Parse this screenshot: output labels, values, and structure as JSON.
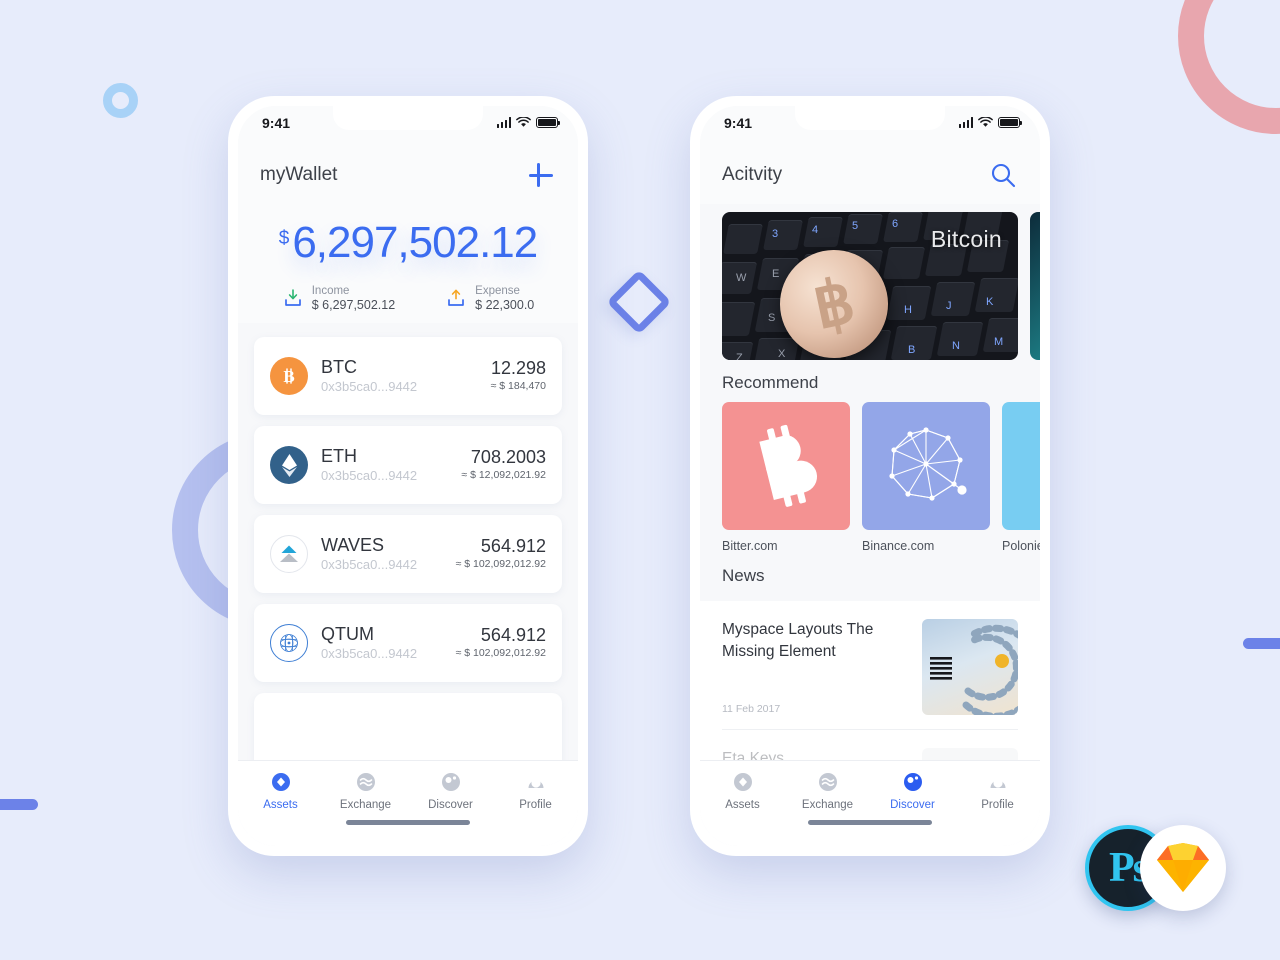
{
  "background": {
    "color": "#e7ecfb",
    "decorations": [
      {
        "name": "ring-small",
        "color": "#a8d2f7"
      },
      {
        "name": "ring-pink",
        "color": "#e8a6ae"
      },
      {
        "name": "ring-periwinkle",
        "color": "#b5c0ef"
      },
      {
        "name": "bar-left",
        "color": "#6c82e8"
      },
      {
        "name": "bar-right",
        "color": "#6c82e8"
      },
      {
        "name": "diamond-mark",
        "color": "#6c82e8"
      }
    ]
  },
  "badges": {
    "photoshop_label": "Ps",
    "photoshop_bg": "#16222c",
    "photoshop_accent": "#31c5f0",
    "sketch_accent": "#f7b500"
  },
  "phone_left": {
    "statusbar": {
      "time": "9:41"
    },
    "header": {
      "title": "myWallet",
      "add_label": "+"
    },
    "balance": {
      "currency_symbol": "$",
      "amount": "6,297,502.12",
      "income_label": "Income",
      "income_value": "$ 6,297,502.12",
      "expense_label": "Expense",
      "expense_value": "$ 22,300.0",
      "accent": "#3b6cf0"
    },
    "coins": [
      {
        "symbol": "BTC",
        "address": "0x3b5ca0...9442",
        "amount": "12.298",
        "usd": "≈ $ 184,470",
        "icon": "bitcoin-icon",
        "color": "#f5943f"
      },
      {
        "symbol": "ETH",
        "address": "0x3b5ca0...9442",
        "amount": "708.2003",
        "usd": "≈ $ 12,092,021.92",
        "icon": "ethereum-icon",
        "color": "#32618a"
      },
      {
        "symbol": "WAVES",
        "address": "0x3b5ca0...9442",
        "amount": "564.912",
        "usd": "≈ $ 102,092,012.92",
        "icon": "waves-icon",
        "color": "#22a5d8"
      },
      {
        "symbol": "QTUM",
        "address": "0x3b5ca0...9442",
        "amount": "564.912",
        "usd": "≈ $ 102,092,012.92",
        "icon": "qtum-icon",
        "color": "#3f7fd4"
      }
    ],
    "tabs": [
      {
        "label": "Assets",
        "icon": "assets-icon",
        "active": true
      },
      {
        "label": "Exchange",
        "icon": "exchange-icon",
        "active": false
      },
      {
        "label": "Discover",
        "icon": "discover-icon",
        "active": false
      },
      {
        "label": "Profile",
        "icon": "profile-icon",
        "active": false
      }
    ]
  },
  "phone_right": {
    "statusbar": {
      "time": "9:41"
    },
    "header": {
      "title": "Acitvity",
      "search_icon": "search-icon"
    },
    "banners": [
      {
        "label": "Bitcoin",
        "theme": "bitcoin-keyboard"
      },
      {
        "label": "",
        "theme": "teal-abstract"
      }
    ],
    "recommend": {
      "section_title": "Recommend",
      "items": [
        {
          "label": "Bitter.com",
          "tile_color": "#f49292",
          "icon": "bitcoin-glyph-icon"
        },
        {
          "label": "Binance.com",
          "tile_color": "#93a6e8",
          "icon": "network-graph-icon"
        },
        {
          "label": "Polonie",
          "tile_color": "#78cdf2",
          "icon": "dot-icon"
        }
      ]
    },
    "news": {
      "section_title": "News",
      "items": [
        {
          "title": "Myspace Layouts The Missing Element",
          "date": "11 Feb 2017",
          "thumb": "ibm-rings-thumb"
        },
        {
          "title": "Eta Keys",
          "date": "",
          "thumb": "portrait-thumb"
        }
      ]
    },
    "tabs": [
      {
        "label": "Assets",
        "icon": "assets-icon",
        "active": false
      },
      {
        "label": "Exchange",
        "icon": "exchange-icon",
        "active": false
      },
      {
        "label": "Discover",
        "icon": "discover-icon",
        "active": true
      },
      {
        "label": "Profile",
        "icon": "profile-icon",
        "active": false
      }
    ]
  }
}
